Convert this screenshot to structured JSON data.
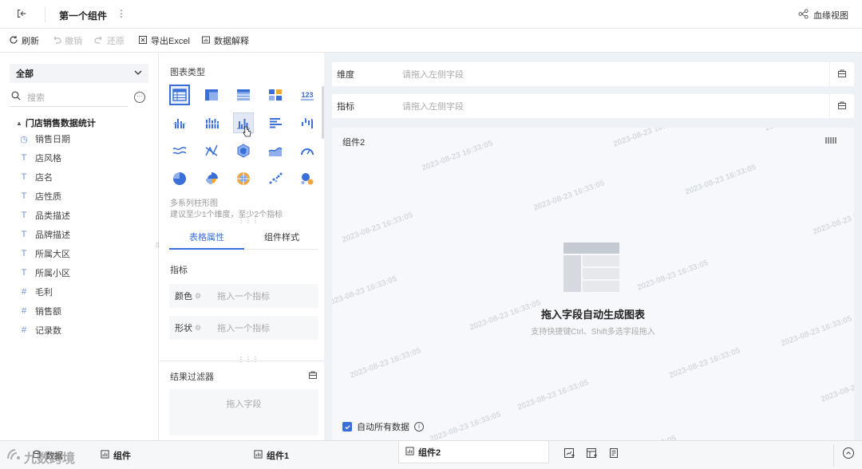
{
  "topbar": {
    "title": "第一个组件",
    "lineage_label": "血缘视图"
  },
  "toolbar": {
    "refresh": "刷新",
    "undo": "撤销",
    "redo": "还原",
    "export_excel": "导出Excel",
    "data_explain": "数据解释"
  },
  "left": {
    "scope_select": "全部",
    "search_placeholder": "搜索",
    "dataset_name": "门店销售数据统计",
    "fields": [
      {
        "type": "date",
        "icon": "◷",
        "label": "销售日期"
      },
      {
        "type": "text",
        "icon": "T",
        "label": "店风格"
      },
      {
        "type": "text",
        "icon": "T",
        "label": "店名"
      },
      {
        "type": "text",
        "icon": "T",
        "label": "店性质"
      },
      {
        "type": "text",
        "icon": "T",
        "label": "品类描述"
      },
      {
        "type": "text",
        "icon": "T",
        "label": "品牌描述"
      },
      {
        "type": "text",
        "icon": "T",
        "label": "所属大区"
      },
      {
        "type": "text",
        "icon": "T",
        "label": "所属小区"
      },
      {
        "type": "number",
        "icon": "#",
        "label": "毛利"
      },
      {
        "type": "number",
        "icon": "#",
        "label": "销售额"
      },
      {
        "type": "number",
        "icon": "#",
        "label": "记录数"
      }
    ]
  },
  "middle": {
    "chart_type_title": "图表类型",
    "hover_chart_name": "多系列柱形图",
    "hover_chart_hint": "建议至少1个维度，至少2个指标",
    "tabs": [
      "表格属性",
      "组件样式"
    ],
    "metric_section": "指标",
    "color_label": "颜色",
    "color_placeholder": "拖入一个指标",
    "shape_label": "形状",
    "shape_placeholder": "拖入一个指标",
    "result_filter": "结果过滤器",
    "drag_field": "拖入字段"
  },
  "right": {
    "dimension_label": "维度",
    "dimension_placeholder": "请拖入左侧字段",
    "metric_label": "指标",
    "metric_placeholder": "请拖入左侧字段",
    "component_name": "组件2",
    "empty_title": "拖入字段自动生成图表",
    "empty_hint": "支持快捷键Ctrl、Shift多选字段拖入",
    "show_all_data": "自动所有数据",
    "watermark": "2023-08-23 16:33:05"
  },
  "bottom": {
    "tabs": [
      "数据",
      "组件1",
      "组件2"
    ],
    "logo_text": "九数跨境"
  },
  "colors": {
    "accent": "#3a6fd8",
    "canvas_bg": "#eef1f6"
  }
}
